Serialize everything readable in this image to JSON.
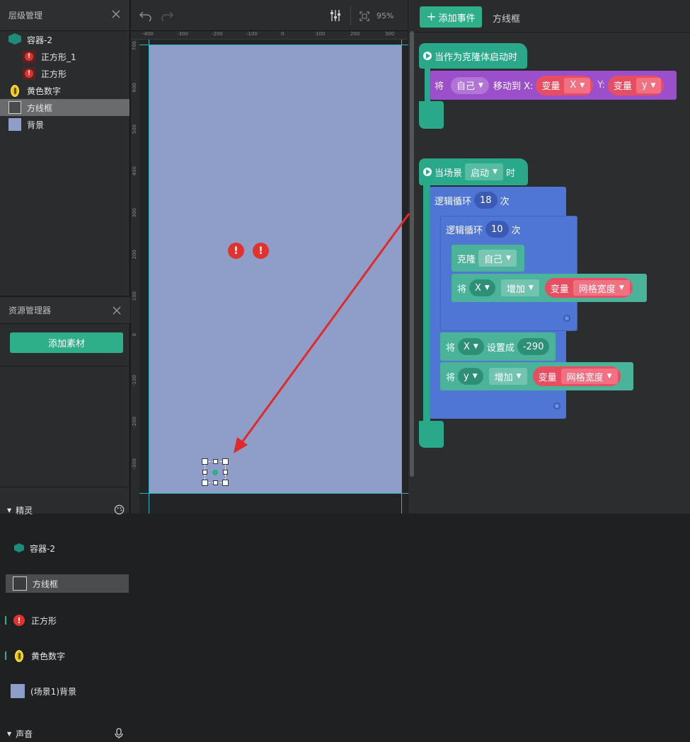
{
  "layers_panel": {
    "title": "层级管理",
    "items": [
      {
        "label": "容器-2",
        "icon": "container-cube-icon",
        "indent": 0
      },
      {
        "label": "正方形_1",
        "icon": "error-badge-icon",
        "indent": 1
      },
      {
        "label": "正方形",
        "icon": "error-badge-icon",
        "indent": 1
      },
      {
        "label": "黄色数字",
        "icon": "gold-coin-icon",
        "indent": 0
      },
      {
        "label": "方线框",
        "icon": "square-frame-icon",
        "indent": 0,
        "selected": true
      },
      {
        "label": "背景",
        "icon": "background-swatch-icon",
        "indent": 0
      }
    ]
  },
  "assets_panel": {
    "title": "资源管理器",
    "add_button": "添加素材",
    "sprites_header": "精灵",
    "sprites": [
      {
        "label": "容器-2",
        "icon": "container-cube-icon"
      },
      {
        "label": "方线框",
        "icon": "square-frame-icon",
        "selected": true
      },
      {
        "label": "正方形",
        "icon": "error-badge-icon"
      },
      {
        "label": "黄色数字",
        "icon": "gold-coin-icon"
      },
      {
        "label": "(场景1)背景",
        "icon": "background-swatch-icon"
      }
    ],
    "sound_header": "声音"
  },
  "canvas": {
    "zoom": "95%",
    "ruler_labels": [
      "-400",
      "-300",
      "-200",
      "-100",
      "0",
      "100",
      "200",
      "300"
    ],
    "vruler_labels": [
      "700",
      "600",
      "500",
      "400",
      "300",
      "200",
      "100",
      "0",
      "-100",
      "-200",
      "-300"
    ],
    "error_marker": "!",
    "stage_color": "#8e9ec9"
  },
  "script_panel": {
    "add_event_button": "添加事件",
    "sprite_tab": "方线框",
    "block1": {
      "hat": "当作为克隆体启动时",
      "cmd_prefix": "将",
      "cmd_target": "自己",
      "cmd_verb": "移动到 X:",
      "var_label": "变量",
      "var_x": "X",
      "y_label": "Y:",
      "var_y": "y"
    },
    "block2": {
      "hat_prefix": "当场景",
      "hat_event": "启动",
      "hat_suffix": "时",
      "loop1_label": "逻辑循环",
      "loop1_count": "18",
      "loop1_unit": "次",
      "loop2_label": "逻辑循环",
      "loop2_count": "10",
      "loop2_unit": "次",
      "clone_label": "克隆",
      "clone_target": "自己",
      "inc1_prefix": "将",
      "inc1_var": "X",
      "inc1_op": "增加",
      "inc1_vlabel": "变量",
      "inc1_vname": "网格宽度",
      "set_prefix": "将",
      "set_var": "X",
      "set_op": "设置成",
      "set_value": "-290",
      "inc2_prefix": "将",
      "inc2_var": "y",
      "inc2_op": "增加",
      "inc2_vlabel": "变量",
      "inc2_vname": "网格宽度"
    }
  },
  "colors": {
    "accent": "#2fae8a",
    "event_hat": "#2aa98a",
    "motion_block": "#9b4fcb",
    "loop_block": "#4f76d4",
    "looks_block": "#4bb39a",
    "variable": "#e84e62",
    "error": "#e0332d",
    "arrow": "#e02a2a"
  }
}
